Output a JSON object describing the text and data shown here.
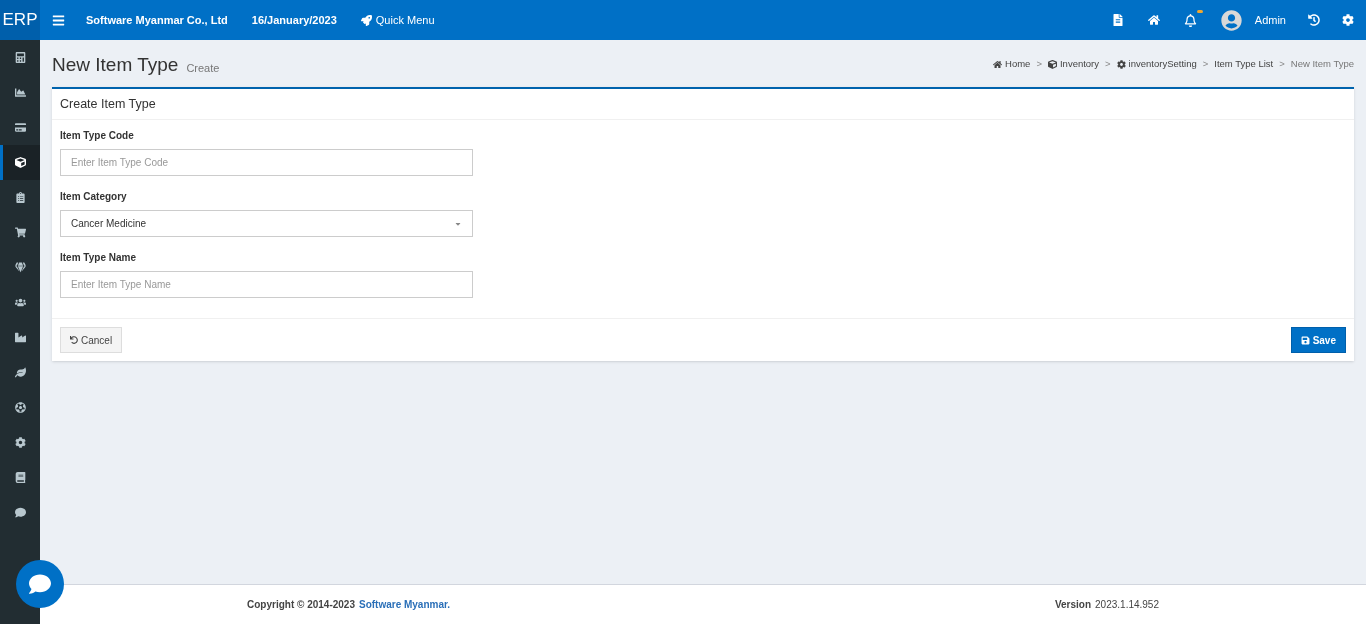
{
  "topbar": {
    "logo": "ERP",
    "company": "Software Myanmar Co., Ltd",
    "date": "16/January/2023",
    "quick_menu": "Quick Menu",
    "user": "Admin",
    "notification_dot": true
  },
  "sidebar": {
    "items": [
      {
        "kind": "calculator",
        "selected": false
      },
      {
        "kind": "chart",
        "selected": false
      },
      {
        "kind": "card",
        "selected": false
      },
      {
        "kind": "cube",
        "selected": true
      },
      {
        "kind": "clipboard",
        "selected": false
      },
      {
        "kind": "cart",
        "selected": false
      },
      {
        "kind": "gem",
        "selected": false
      },
      {
        "kind": "users",
        "selected": false
      },
      {
        "kind": "industry",
        "selected": false
      },
      {
        "kind": "leaf",
        "selected": false
      },
      {
        "kind": "ball",
        "selected": false
      },
      {
        "kind": "cog",
        "selected": false
      },
      {
        "kind": "book",
        "selected": false
      },
      {
        "kind": "comment",
        "selected": false
      }
    ]
  },
  "page": {
    "title": "New Item Type",
    "subtitle": "Create"
  },
  "breadcrumb": {
    "separator": ">",
    "items": [
      {
        "label": "Home",
        "kind": "home"
      },
      {
        "label": "Inventory",
        "kind": "cube"
      },
      {
        "label": "inventorySetting",
        "kind": "cog"
      },
      {
        "label": "Item Type List",
        "kind": "plain"
      },
      {
        "label": "New Item Type",
        "kind": "current"
      }
    ]
  },
  "form": {
    "title": "Create Item Type",
    "fields": [
      {
        "label": "Item Type Code",
        "kind": "text",
        "placeholder": "Enter Item Type Code"
      },
      {
        "label": "Item Category",
        "kind": "select",
        "value": "Cancer Medicine"
      },
      {
        "label": "Item Type Name",
        "kind": "text",
        "placeholder": "Enter Item Type Name"
      }
    ],
    "cancel": "Cancel",
    "save": "Save"
  },
  "footer": {
    "copyright": "Copyright © 2014-2023",
    "company": "Software Myanmar.",
    "version_label": "Version",
    "version": "2023.1.14.952"
  }
}
